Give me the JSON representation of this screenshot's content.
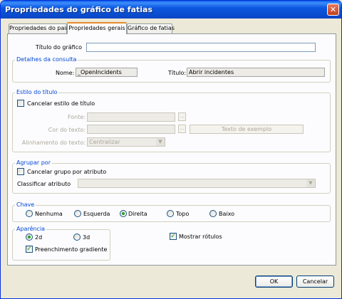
{
  "window": {
    "title": "Propriedades do gráfico de fatias",
    "close_glyph": "✕"
  },
  "tabs": [
    {
      "label": "Propriedades do painel",
      "active": false
    },
    {
      "label": "Propriedades gerais",
      "active": true
    },
    {
      "label": "Gráfico de fatias",
      "active": false
    }
  ],
  "general": {
    "chart_title_label": "Título do gráfico",
    "chart_title_value": ""
  },
  "query_details": {
    "title": "Detalhes da consulta",
    "name_label": "Nome:",
    "name_value": "_OpenIncidents",
    "title_label": "Título:",
    "title_value": "Abrir incidentes"
  },
  "title_style": {
    "title": "Estilo do título",
    "override_label": "Cancelar estilo de título",
    "override_checked": false,
    "font_label": "Fonte:",
    "font_value": "",
    "text_color_label": "Cor do texto:",
    "text_color_value": "",
    "ellipsis": "...",
    "sample_text": "Texto de exemplo",
    "alignment_label": "Alinhamento do texto:",
    "alignment_value": "Centralizar"
  },
  "group_by": {
    "title": "Agrupar por",
    "override_label": "Cancelar grupo por atributo",
    "override_checked": false,
    "sort_label": "Classificar atributo",
    "sort_value": ""
  },
  "key": {
    "title": "Chave",
    "options": [
      "Nenhuma",
      "Esquerda",
      "Direita",
      "Topo",
      "Baixo"
    ],
    "selected": "Direita"
  },
  "appearance": {
    "title": "Aparência",
    "option_2d": "2d",
    "option_3d": "3d",
    "selected": "2d",
    "gradient_fill_label": "Preenchimento gradiente",
    "gradient_fill_checked": true,
    "show_labels_label": "Mostrar rótulos",
    "show_labels_checked": true
  },
  "footer": {
    "ok_label": "OK",
    "cancel_label": "Cancelar"
  },
  "colors": {
    "titlebar": "#0a4dd0",
    "group_title": "#0046d5",
    "check_mark": "#21a121"
  },
  "icons": {
    "dropdown": "chevron-down-icon",
    "check": "checkmark-icon",
    "close": "close-icon"
  }
}
